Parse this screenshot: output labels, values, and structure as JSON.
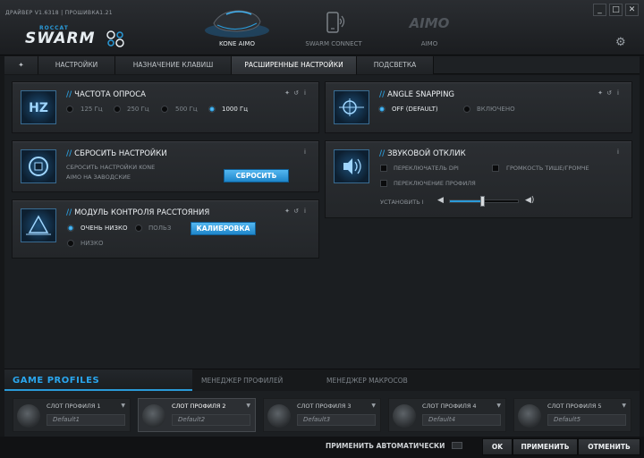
{
  "window": {
    "version": "ДРАЙВЕР V1.6318 | ПРОШИВКА1.21",
    "brand_small": "ROCCAT",
    "brand_big": "SWARM",
    "minimize": "_",
    "maximize": "□",
    "close": "✕"
  },
  "devices": [
    {
      "label": "KONE AIMO",
      "active": true
    },
    {
      "label": "SWARM CONNECT",
      "active": false
    },
    {
      "label": "AIMO",
      "active": false
    }
  ],
  "tabs": {
    "pin": "✦",
    "items": [
      "НАСТРОЙКИ",
      "НАЗНАЧЕНИЕ КЛАВИШ",
      "РАСШИРЕННЫЕ НАСТРОЙКИ",
      "ПОДСВЕТКА"
    ],
    "active": "РАСШИРЕННЫЕ НАСТРОЙКИ"
  },
  "panel_controls": {
    "pin": "✦",
    "reset": "↺",
    "info": "i"
  },
  "polling": {
    "title": "ЧАСТОТА ОПРОСА",
    "options": [
      "125 Гц",
      "250 Гц",
      "500 Гц",
      "1000 Гц"
    ],
    "selected": "1000 Гц"
  },
  "reset": {
    "title": "СБРОСИТЬ НАСТРОЙКИ",
    "desc_line1": "СБРОСИТЬ НАСТРОЙКИ KONE",
    "desc_line2": "AIMO НА ЗАВОДСКИЕ",
    "button": "СБРОСИТЬ"
  },
  "distance": {
    "title": "МОДУЛЬ КОНТРОЛЯ РАССТОЯНИЯ",
    "options": [
      "ОЧЕНЬ НИЗКО",
      "ПОЛЬЗ",
      "НИЗКО"
    ],
    "selected": "ОЧЕНЬ НИЗКО",
    "button": "КАЛИБРОВКА"
  },
  "angle": {
    "title": "ANGLE SNAPPING",
    "options": [
      "OFF (DEFAULT)",
      "ВКЛЮЧЕНО"
    ],
    "selected": "OFF (DEFAULT)"
  },
  "sound": {
    "title": "ЗВУКОВОЙ ОТКЛИК",
    "checks": [
      "ПЕРЕКЛЮЧАТЕЛЬ DPI",
      "ГРОМКОСТЬ ТИШЕ/ГРОМЧЕ",
      "ПЕРЕКЛЮЧЕНИЕ ПРОФИЛЯ"
    ],
    "volume_label": "УСТАНОВИТЬ I",
    "volume_level": 0.48
  },
  "profiles": {
    "title": "GAME PROFILES",
    "tabs": [
      "МЕНЕДЖЕР ПРОФИЛЕЙ",
      "МЕНЕДЖЕР МАКРОСОВ"
    ],
    "slots": [
      {
        "name": "СЛОТ ПРОФИЛЯ 1",
        "value": "Default1"
      },
      {
        "name": "СЛОТ ПРОФИЛЯ 2",
        "value": "Default2"
      },
      {
        "name": "СЛОТ ПРОФИЛЯ 3",
        "value": "Default3"
      },
      {
        "name": "СЛОТ ПРОФИЛЯ 4",
        "value": "Default4"
      },
      {
        "name": "СЛОТ ПРОФИЛЯ 5",
        "value": "Default5"
      }
    ],
    "active_slot": "СЛОТ ПРОФИЛЯ 2",
    "dropdown_arrow": "▼"
  },
  "footer": {
    "auto_apply": "ПРИМЕНИТЬ АВТОМАТИЧЕСКИ",
    "ok": "OK",
    "apply": "ПРИМЕНИТЬ",
    "cancel": "ОТМЕНИТЬ"
  },
  "colors": {
    "accent": "#2a9ad8",
    "background": "#151719",
    "panel": "#2b2e32"
  }
}
